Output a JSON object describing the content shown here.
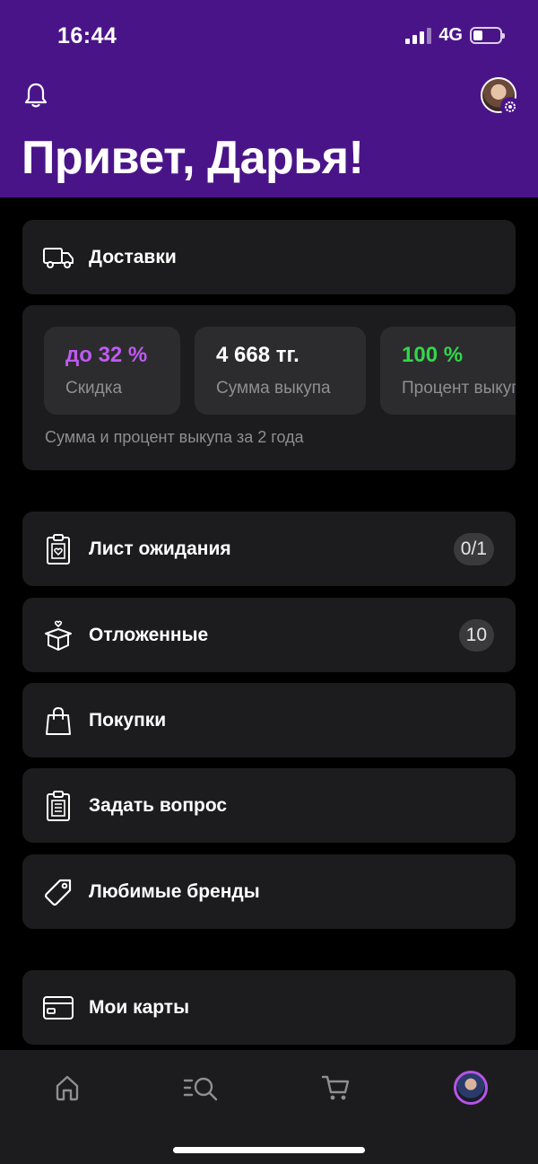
{
  "status_bar": {
    "time": "16:44",
    "network": "4G",
    "battery_level": 0.35
  },
  "header": {
    "greeting": "Привет, Дарья!",
    "icons": [
      "bell-icon",
      "avatar-with-gear-icon"
    ]
  },
  "delivery": {
    "label": "Доставки",
    "icon": "truck-icon"
  },
  "stats": {
    "tiles": [
      {
        "value": "до 32 %",
        "caption": "Скидка",
        "color": "#bf5af2"
      },
      {
        "value": "4 668 тг.",
        "caption": "Сумма выкупа",
        "color": "#ffffff"
      },
      {
        "value": "100 %",
        "caption": "Процент выкупа",
        "color": "#32d74b"
      }
    ],
    "note": "Сумма и процент выкупа за 2 года"
  },
  "menu": [
    {
      "label": "Лист ожидания",
      "icon": "clipboard-heart-icon",
      "badge": "0/1"
    },
    {
      "label": "Отложенные",
      "icon": "gift-box-icon",
      "badge": "10"
    },
    {
      "label": "Покупки",
      "icon": "shopping-bag-icon"
    },
    {
      "label": "Задать вопрос",
      "icon": "clipboard-list-icon"
    },
    {
      "label": "Любимые бренды",
      "icon": "tag-icon"
    }
  ],
  "cards": {
    "label": "Мои карты",
    "icon": "credit-card-icon"
  },
  "tabbar": {
    "tabs": [
      "home-icon",
      "search-icon",
      "cart-icon",
      "profile-avatar"
    ],
    "active": "profile-avatar",
    "accent": "#b455e6"
  },
  "colors": {
    "header_bg": "#4a1489",
    "card_bg": "#1c1c1e",
    "page_bg": "#000000"
  }
}
